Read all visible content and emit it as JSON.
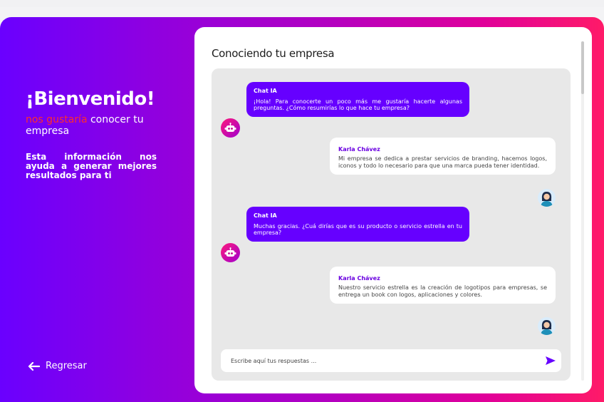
{
  "left": {
    "title": "¡Bienvenido!",
    "subtitle_accent": "nos gustaría",
    "subtitle_rest": " conocer tu empresa",
    "info": "Esta información nos ayuda a generar mejores resultados para ti",
    "back_label": "Regresar"
  },
  "panel": {
    "title": "Conociendo tu empresa"
  },
  "messages": [
    {
      "sender": "Chat IA",
      "text": "¡Hola! Para conocerte un poco más me gustaría hacerte algunas preguntas. ¿Cómo resumirías lo que hace tu empresa?"
    },
    {
      "sender": "Karla Chávez",
      "text": "Mi empresa se dedica a prestar servicios de branding, hacemos logos, iconos y todo lo necesario para que una marca pueda tener identidad."
    },
    {
      "sender": "Chat IA",
      "text": "Muchas gracias. ¿Cuá dirías que es su producto o servicio estrella en tu empresa?"
    },
    {
      "sender": "Karla Chávez",
      "text": "Nuestro servicio estrella es la creación de logotipos para empresas, se entrega un book con logos, aplicaciones y colores."
    }
  ],
  "input": {
    "placeholder": "Escribe aquí tus respuestas ..."
  },
  "colors": {
    "brand_purple": "#6600ff",
    "brand_pink": "#ff1a68",
    "accent_red": "#ff2d2d"
  },
  "icons": {
    "back": "arrow-left-icon",
    "send": "send-icon",
    "bot": "robot-icon",
    "user": "user-avatar"
  }
}
